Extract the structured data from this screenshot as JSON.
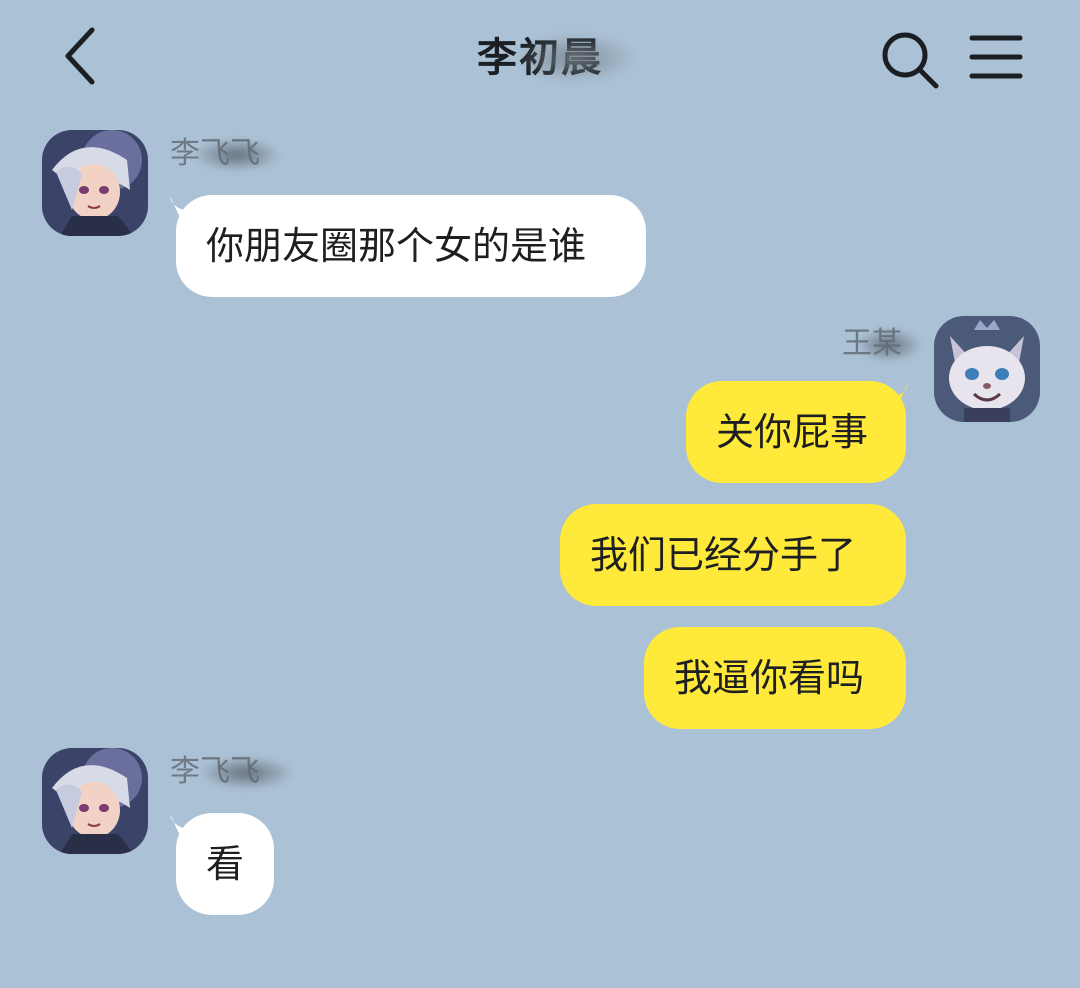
{
  "header": {
    "title": "李初晨",
    "back_icon": "chevron-left-icon",
    "search_icon": "search-icon",
    "menu_icon": "hamburger-menu-icon"
  },
  "colors": {
    "background": "#abc1d5",
    "incoming_bubble": "#ffffff",
    "outgoing_bubble": "#ffe93b",
    "text": "#1d1f22"
  },
  "messages": [
    {
      "direction": "incoming",
      "sender": "李飞飞",
      "text": "你朋友圈那个女的是谁"
    },
    {
      "direction": "outgoing",
      "sender": "王某",
      "text": "关你屁事"
    },
    {
      "direction": "outgoing",
      "text": "我们已经分手了"
    },
    {
      "direction": "outgoing",
      "text": "我逼你看吗"
    },
    {
      "direction": "incoming",
      "sender": "李飞飞",
      "text": "看"
    }
  ]
}
